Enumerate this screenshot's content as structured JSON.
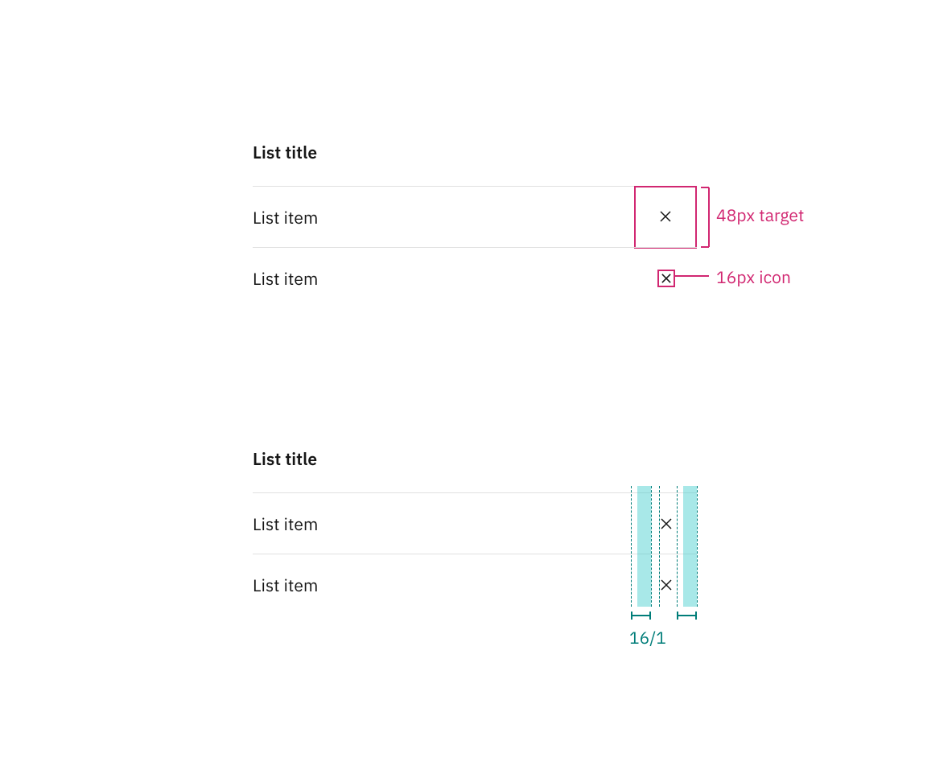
{
  "colors": {
    "annotation_pink": "#d12771",
    "annotation_teal": "#007d79",
    "divider": "#e0e0e0",
    "text": "#161616",
    "spacing_fill": "rgba(62,205,205,0.45)"
  },
  "list1": {
    "title": "List title",
    "items": [
      "List item",
      "List item"
    ],
    "annotations": {
      "target": "48px target",
      "icon": "16px icon"
    }
  },
  "list2": {
    "title": "List title",
    "items": [
      "List item",
      "List item"
    ],
    "spacing_label": "16/1"
  }
}
